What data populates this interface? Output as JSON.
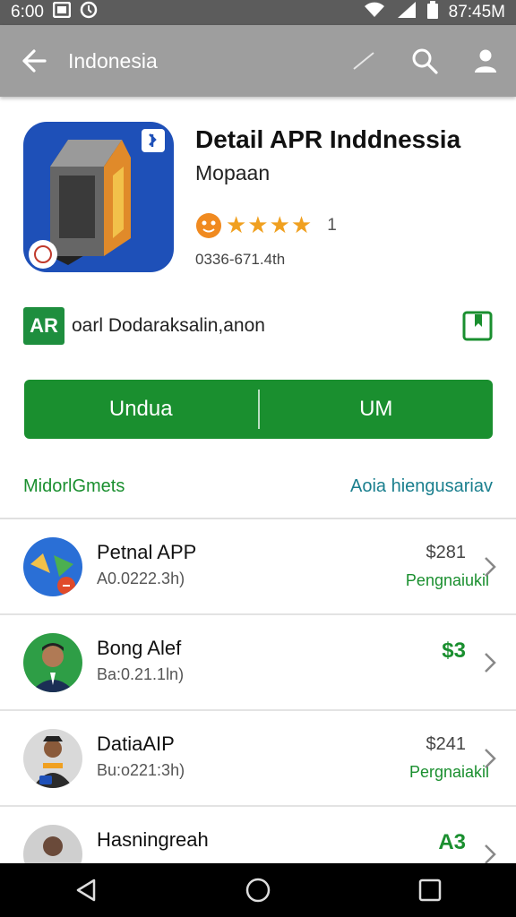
{
  "status_bar": {
    "time": "6:00",
    "right_time": "87:45M",
    "icons": [
      "photo-icon",
      "clock-icon",
      "wifi-icon",
      "signal-icon",
      "battery-icon"
    ]
  },
  "app_bar": {
    "title": "Indonesia",
    "icons": [
      "back-arrow-icon",
      "check-icon",
      "search-icon",
      "account-icon"
    ]
  },
  "app": {
    "title": "Detail APR Inddnessia",
    "developer": "Mopaan",
    "stars": "★★★★",
    "rating_count": "1",
    "meta": "0336-671.4th"
  },
  "info": {
    "badge": "AR",
    "text": "oarl Dodaraksalin,anon"
  },
  "buttons": {
    "left": "Undua",
    "right": "UM"
  },
  "links": {
    "left": "MidorlGmets",
    "right": "Aoia hiengusariav"
  },
  "list": [
    {
      "title": "Petnal APP",
      "subtitle": "A0.0222.3h)",
      "price": "$281",
      "action": "Pengnaiukil",
      "price_green": false
    },
    {
      "title": "Bong Alef",
      "subtitle": "Ba:0.21.1ln)",
      "price": "$3",
      "action": "",
      "price_green": true
    },
    {
      "title": "DatiaAIP",
      "subtitle": "Bu:o221:3h)",
      "price": "$241",
      "action": "Pergnaiakil",
      "price_green": false
    },
    {
      "title": "Hasningreah",
      "subtitle": "",
      "price": "A3",
      "action": "",
      "price_green": true
    }
  ],
  "colors": {
    "accent_green": "#1a8f2f",
    "app_bar": "#9e9e9e",
    "status_bar": "#5c5c5c",
    "star": "#f0a020"
  }
}
